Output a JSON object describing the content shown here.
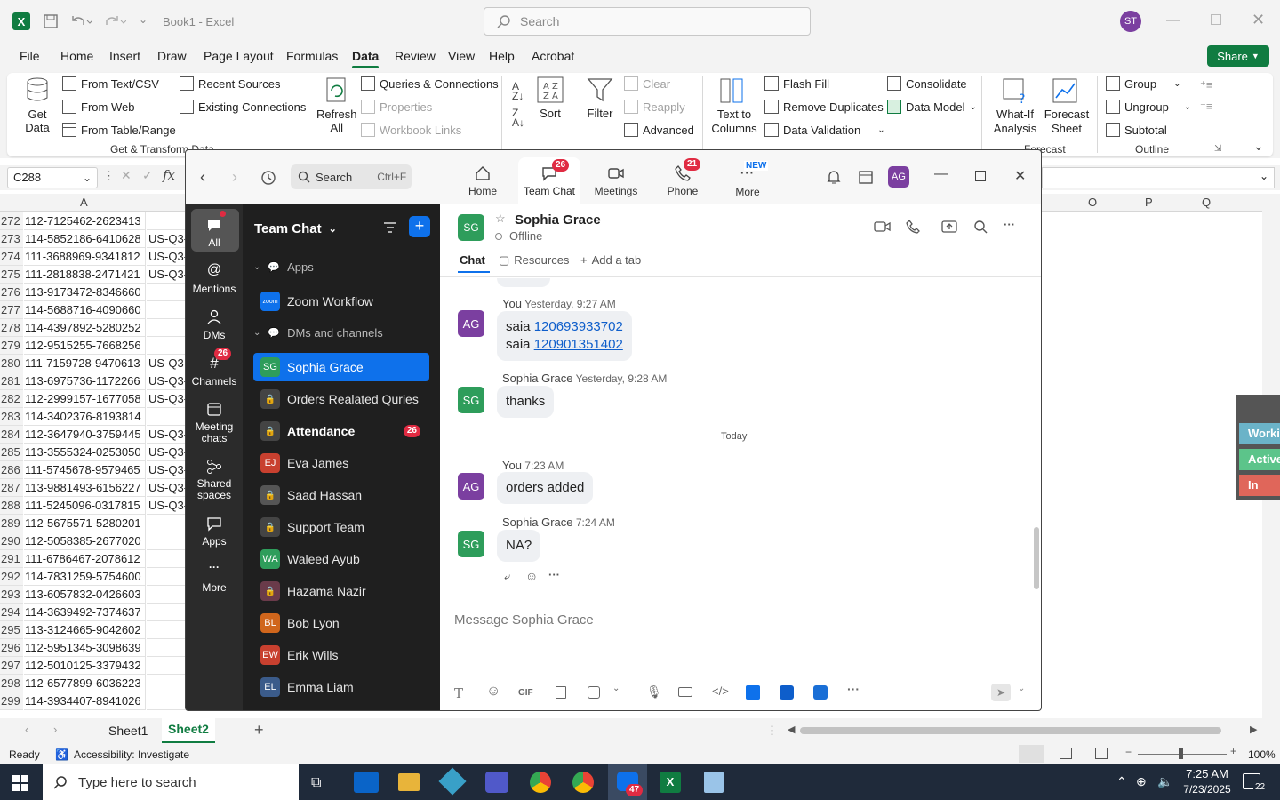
{
  "excel": {
    "title": "Book1  -  Excel",
    "search_placeholder": "Search",
    "user_initials": "ST",
    "tabs": [
      "File",
      "Home",
      "Insert",
      "Draw",
      "Page Layout",
      "Formulas",
      "Data",
      "Review",
      "View",
      "Help",
      "Acrobat"
    ],
    "share": "Share",
    "ribbon": {
      "get_data": "Get Data",
      "from_text": "From Text/CSV",
      "from_web": "From Web",
      "from_table": "From Table/Range",
      "recent_sources": "Recent Sources",
      "existing_connections": "Existing Connections",
      "refresh_all": "Refresh All",
      "queries_connections": "Queries & Connections",
      "properties": "Properties",
      "workbook_links": "Workbook Links",
      "sort": "Sort",
      "filter": "Filter",
      "clear": "Clear",
      "reapply": "Reapply",
      "advanced": "Advanced",
      "text_to_columns": "Text to Columns",
      "flash_fill": "Flash Fill",
      "remove_duplicates": "Remove Duplicates",
      "data_validation": "Data Validation",
      "consolidate": "Consolidate",
      "data_model": "Data Model",
      "what_if": "What-If Analysis",
      "forecast_sheet": "Forecast Sheet",
      "group": "Group",
      "ungroup": "Ungroup",
      "subtotal": "Subtotal",
      "grp_get_transform": "Get & Transform Data",
      "grp_forecast": "Forecast",
      "grp_outline": "Outline"
    },
    "name_box": "C288",
    "columns": [
      "A",
      "O",
      "P",
      "Q"
    ],
    "rows": [
      {
        "n": "272",
        "a": "112-7125462-2623413",
        "b": ""
      },
      {
        "n": "273",
        "a": "114-5852186-6410628",
        "b": "US-Q3-"
      },
      {
        "n": "274",
        "a": "111-3688969-9341812",
        "b": "US-Q3-"
      },
      {
        "n": "275",
        "a": "111-2818838-2471421",
        "b": "US-Q3-"
      },
      {
        "n": "276",
        "a": "113-9173472-8346660",
        "b": ""
      },
      {
        "n": "277",
        "a": "114-5688716-4090660",
        "b": ""
      },
      {
        "n": "278",
        "a": "114-4397892-5280252",
        "b": ""
      },
      {
        "n": "279",
        "a": "112-9515255-7668256",
        "b": ""
      },
      {
        "n": "280",
        "a": "111-7159728-9470613",
        "b": "US-Q3-"
      },
      {
        "n": "281",
        "a": "113-6975736-1172266",
        "b": "US-Q3-"
      },
      {
        "n": "282",
        "a": "112-2999157-1677058",
        "b": "US-Q3-"
      },
      {
        "n": "283",
        "a": "114-3402376-8193814",
        "b": ""
      },
      {
        "n": "284",
        "a": "112-3647940-3759445",
        "b": "US-Q3-"
      },
      {
        "n": "285",
        "a": "113-3555324-0253050",
        "b": "US-Q3-"
      },
      {
        "n": "286",
        "a": "111-5745678-9579465",
        "b": "US-Q3-"
      },
      {
        "n": "287",
        "a": "113-9881493-6156227",
        "b": "US-Q3-"
      },
      {
        "n": "288",
        "a": "111-5245096-0317815",
        "b": "US-Q3-"
      },
      {
        "n": "289",
        "a": "112-5675571-5280201",
        "b": ""
      },
      {
        "n": "290",
        "a": "112-5058385-2677020",
        "b": ""
      },
      {
        "n": "291",
        "a": "111-6786467-2078612",
        "b": ""
      },
      {
        "n": "292",
        "a": "114-7831259-5754600",
        "b": ""
      },
      {
        "n": "293",
        "a": "113-6057832-0426603",
        "b": ""
      },
      {
        "n": "294",
        "a": "114-3639492-7374637",
        "b": ""
      },
      {
        "n": "295",
        "a": "113-3124665-9042602",
        "b": ""
      },
      {
        "n": "296",
        "a": "112-5951345-3098639",
        "b": ""
      },
      {
        "n": "297",
        "a": "112-5010125-3379432",
        "b": ""
      },
      {
        "n": "298",
        "a": "112-6577899-6036223",
        "b": ""
      },
      {
        "n": "299",
        "a": "114-3934407-8941026",
        "b": ""
      }
    ],
    "side_tags": [
      "Worki",
      "Active",
      "In Acti"
    ],
    "sheets": [
      "Sheet1",
      "Sheet2"
    ],
    "status_ready": "Ready",
    "status_accessibility": "Accessibility: Investigate",
    "zoom_level": "100%"
  },
  "zoom": {
    "search": "Search",
    "search_shortcut": "Ctrl+F",
    "nav": [
      {
        "label": "Home",
        "badge": ""
      },
      {
        "label": "Team Chat",
        "badge": "26"
      },
      {
        "label": "Meetings",
        "badge": ""
      },
      {
        "label": "Phone",
        "badge": "21"
      },
      {
        "label": "More",
        "badge": "NEW"
      }
    ],
    "user_initials": "AG",
    "rail": [
      {
        "label": "All",
        "badge": ""
      },
      {
        "label": "Mentions",
        "badge": ""
      },
      {
        "label": "DMs",
        "badge": ""
      },
      {
        "label": "Channels",
        "badge": "26"
      },
      {
        "label": "Meeting chats",
        "badge": ""
      },
      {
        "label": "Shared spaces",
        "badge": ""
      },
      {
        "label": "Apps",
        "badge": ""
      },
      {
        "label": "More",
        "badge": ""
      }
    ],
    "list_title": "Team Chat",
    "section_apps": "Apps",
    "zoom_workflow": "Zoom Workflow",
    "zoom_logo_text": "zoom",
    "section_dms": "DMs and channels",
    "contacts": [
      {
        "name": "Sophia Grace",
        "initials": "SG",
        "color": "#2e9d5b",
        "badge": ""
      },
      {
        "name": "Orders Realated Quries",
        "initials": "",
        "color": "#444",
        "badge": ""
      },
      {
        "name": "Attendance",
        "initials": "",
        "color": "#444",
        "badge": "26"
      },
      {
        "name": "Eva James",
        "initials": "EJ",
        "color": "#c8402f",
        "badge": ""
      },
      {
        "name": "Saad Hassan",
        "initials": "",
        "color": "#555",
        "badge": ""
      },
      {
        "name": "Support Team",
        "initials": "",
        "color": "#444",
        "badge": ""
      },
      {
        "name": "Waleed Ayub",
        "initials": "WA",
        "color": "#2e9d5b",
        "badge": ""
      },
      {
        "name": "Hazama Nazir",
        "initials": "",
        "color": "#6a3b4a",
        "badge": ""
      },
      {
        "name": "Bob Lyon",
        "initials": "BL",
        "color": "#d0661c",
        "badge": ""
      },
      {
        "name": "Erik Wills",
        "initials": "EW",
        "color": "#c8402f",
        "badge": ""
      },
      {
        "name": "Emma Liam",
        "initials": "EL",
        "color": "#3b5b8a",
        "badge": ""
      }
    ],
    "chat": {
      "name": "Sophia Grace",
      "initials": "SG",
      "status": "Offline",
      "tabs": [
        "Chat",
        "Resources",
        "Add a tab"
      ],
      "day_divider": "Today",
      "messages": [
        {
          "who": "AG",
          "sender": "You",
          "time": "Yesterday, 9:27 AM",
          "lines": [
            "saia ",
            "saia "
          ],
          "links": [
            "120693933702",
            "120901351402"
          ]
        },
        {
          "who": "SG",
          "sender": "Sophia Grace",
          "time": "Yesterday, 9:28 AM",
          "text": "thanks"
        },
        {
          "who": "AG",
          "sender": "You",
          "time": "7:23 AM",
          "text": "orders added"
        },
        {
          "who": "SG",
          "sender": "Sophia Grace",
          "time": "7:24 AM",
          "text": "NA?"
        }
      ],
      "composer_placeholder": "Message Sophia Grace",
      "gif": "GIF"
    }
  },
  "taskbar": {
    "search_placeholder": "Type here to search",
    "time": "7:25 AM",
    "date": "7/23/2025",
    "zoom_badge": "47",
    "notif_count": "22"
  },
  "colors": {
    "excel_green": "#107c41",
    "zoom_blue": "#0e71eb",
    "badge_red": "#e02b42",
    "sg_green": "#2e9d5b",
    "ag_purple": "#7b3fa0"
  }
}
